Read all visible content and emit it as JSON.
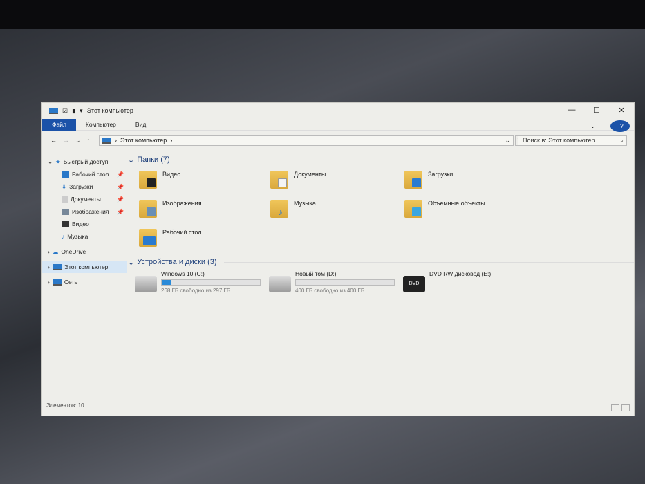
{
  "window": {
    "title": "Этот компьютер",
    "minimize": "—",
    "maximize": "☐",
    "close": "✕"
  },
  "ribbon": {
    "tabs": [
      "Файл",
      "Компьютер",
      "Вид"
    ],
    "expand": "⌄",
    "help": "?"
  },
  "nav": {
    "back": "←",
    "forward": "→",
    "recent": "⌄",
    "up": "↑",
    "path": "Этот компьютер",
    "sep": "›",
    "dropdown": "⌄",
    "refresh": "↻",
    "search_placeholder": "Поиск в: Этот компьютер",
    "search_icon": "⌕"
  },
  "sidebar": {
    "items": [
      {
        "label": "Быстрый доступ",
        "icon": "star-icon",
        "pinned": false
      },
      {
        "label": "Рабочий стол",
        "icon": "desktop-icon",
        "pinned": true
      },
      {
        "label": "Загрузки",
        "icon": "download-icon",
        "pinned": true
      },
      {
        "label": "Документы",
        "icon": "documents-icon",
        "pinned": true
      },
      {
        "label": "Изображения",
        "icon": "pictures-icon",
        "pinned": true
      },
      {
        "label": "Видео",
        "icon": "video-icon",
        "pinned": false
      },
      {
        "label": "Музыка",
        "icon": "music-icon",
        "pinned": false
      },
      {
        "label": "OneDrive",
        "icon": "cloud-icon",
        "pinned": false
      },
      {
        "label": "Этот компьютер",
        "icon": "computer-icon",
        "pinned": false
      },
      {
        "label": "Сеть",
        "icon": "network-icon",
        "pinned": false
      }
    ]
  },
  "folders": {
    "header": "Папки (7)",
    "items": [
      "Видео",
      "Документы",
      "Загрузки",
      "Изображения",
      "Музыка",
      "Объемные объекты",
      "Рабочий стол"
    ]
  },
  "drives": {
    "header": "Устройства и диски (3)",
    "items": [
      {
        "name": "Windows 10 (C:)",
        "free": "268 ГБ свободно из 297 ГБ",
        "used_fraction": 0.098
      },
      {
        "name": "Новый том (D:)",
        "free": "400 ГБ свободно из 400 ГБ",
        "used_fraction": 0.0
      },
      {
        "name": "DVD RW дисковод (E:)",
        "badge": "DVD"
      }
    ]
  },
  "status": "Элементов: 10",
  "colors": {
    "accent": "#1b52a8",
    "bar": "#2a8ad8"
  }
}
